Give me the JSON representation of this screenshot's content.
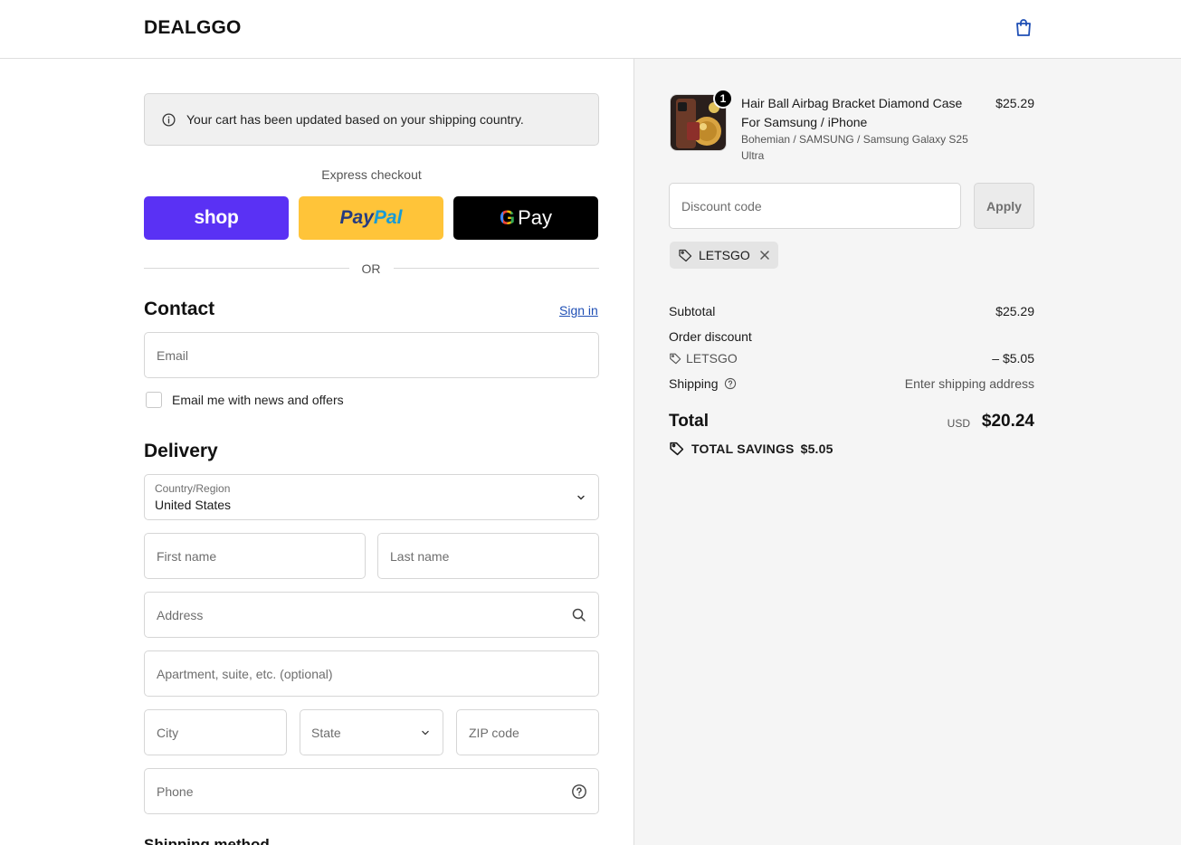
{
  "header": {
    "logo": "DEALGGO",
    "cart_icon": "shopping-bag-icon"
  },
  "notice": {
    "text": "Your cart has been updated based on your shipping country.",
    "icon": "info-icon"
  },
  "express": {
    "label": "Express checkout",
    "shop_label": "shop",
    "paypal_part1": "Pay",
    "paypal_part2": "Pal",
    "gpay_g": "G",
    "gpay_label": "Pay",
    "or_text": "OR"
  },
  "contact": {
    "title": "Contact",
    "sign_in": "Sign in",
    "email_placeholder": "Email",
    "newsletter_label": "Email me with news and offers"
  },
  "delivery": {
    "title": "Delivery",
    "country_label": "Country/Region",
    "country_value": "United States",
    "first_name_placeholder": "First name",
    "last_name_placeholder": "Last name",
    "address_placeholder": "Address",
    "apartment_placeholder": "Apartment, suite, etc. (optional)",
    "city_placeholder": "City",
    "state_placeholder": "State",
    "zip_placeholder": "ZIP code",
    "phone_placeholder": "Phone"
  },
  "shipping_method": {
    "title": "Shipping method"
  },
  "summary": {
    "product": {
      "quantity": "1",
      "name": "Hair Ball Airbag Bracket Diamond Case For Samsung / iPhone",
      "variant": "Bohemian / SAMSUNG / Samsung Galaxy S25 Ultra",
      "price": "$25.29"
    },
    "discount_placeholder": "Discount code",
    "apply_label": "Apply",
    "applied_code": "LETSGO",
    "subtotal_label": "Subtotal",
    "subtotal_value": "$25.29",
    "order_discount_label": "Order discount",
    "order_discount_code": "LETSGO",
    "order_discount_value": "– $5.05",
    "shipping_label": "Shipping",
    "shipping_value": "Enter shipping address",
    "total_label": "Total",
    "total_currency": "USD",
    "total_value": "$20.24",
    "savings_label": "TOTAL SAVINGS",
    "savings_value": "$5.05"
  },
  "colors": {
    "shop_pay": "#5a31f4",
    "paypal_yellow": "#ffc439",
    "gpay_black": "#000000",
    "link_blue": "#1f4fb5",
    "sidebar_bg": "#f5f5f5"
  }
}
